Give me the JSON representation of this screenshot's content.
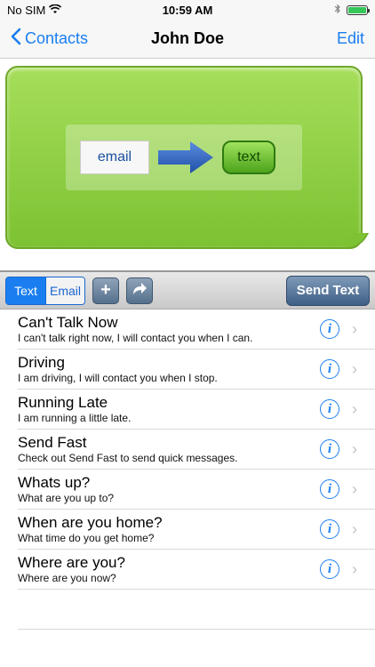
{
  "status": {
    "carrier": "No SIM",
    "time": "10:59 AM"
  },
  "nav": {
    "back_label": "Contacts",
    "title": "John Doe",
    "edit_label": "Edit"
  },
  "preview": {
    "email_label": "email",
    "text_label": "text"
  },
  "toolbar": {
    "seg_text": "Text",
    "seg_email": "Email",
    "add_icon": "+",
    "send_label": "Send Text"
  },
  "messages": [
    {
      "title": "Can't Talk Now",
      "body": "I can't talk right now, I will contact you when I can."
    },
    {
      "title": "Driving",
      "body": "I am driving, I will contact you when I stop."
    },
    {
      "title": "Running Late",
      "body": "I am running a little late."
    },
    {
      "title": "Send Fast",
      "body": "Check out Send Fast to send quick messages."
    },
    {
      "title": "Whats up?",
      "body": "What are you up to?"
    },
    {
      "title": "When are you home?",
      "body": "What time do you get home?"
    },
    {
      "title": "Where are you?",
      "body": "Where are you now?"
    }
  ],
  "colors": {
    "accent": "#1a7ef0",
    "bubble_green": "#8fd043",
    "send_button": "#4f6f96"
  },
  "icons": [
    "wifi-icon",
    "bluetooth-icon",
    "battery-icon",
    "chevron-left-icon",
    "arrow-right-icon",
    "plus-icon",
    "forward-icon",
    "info-icon",
    "chevron-right-icon"
  ]
}
